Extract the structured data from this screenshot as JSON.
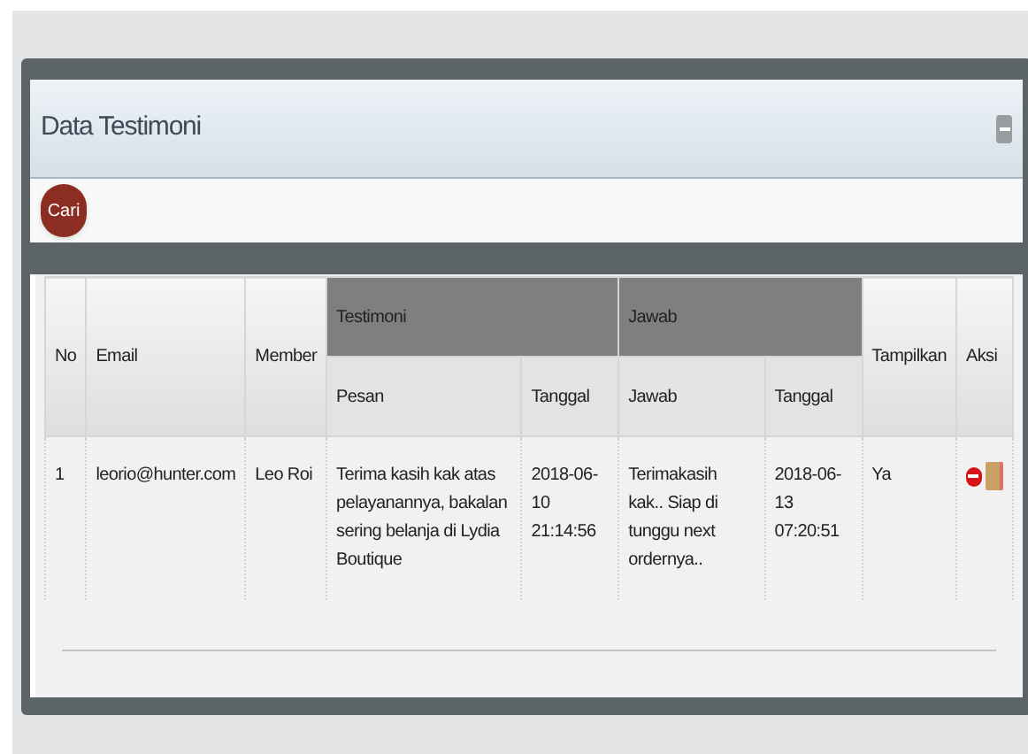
{
  "panel": {
    "title": "Data Testimoni",
    "search_button": "Cari"
  },
  "table": {
    "columns": [
      {
        "label": "No"
      },
      {
        "label": "Email"
      },
      {
        "label": "Member"
      },
      {
        "label": "Testimoni",
        "children": [
          {
            "label": "Pesan"
          },
          {
            "label": "Tanggal"
          }
        ]
      },
      {
        "label": "Jawab",
        "children": [
          {
            "label": "Jawab"
          },
          {
            "label": "Tanggal"
          }
        ]
      },
      {
        "label": "Tampilkan"
      },
      {
        "label": "Aksi"
      }
    ],
    "rows": [
      {
        "no": "1",
        "email": "leorio@hunter.com",
        "member": "Leo Roi",
        "pesan": "Terima kasih kak atas pelayanannya, bakalan sering belanja di Lydia Boutique",
        "tanggal_pesan": "2018-06-10 21:14:56",
        "jawab": "Terimakasih kak.. Siap di tunggu next ordernya..",
        "tanggal_jawab": "2018-06-13 07:20:51",
        "tampilkan": "Ya"
      }
    ]
  }
}
